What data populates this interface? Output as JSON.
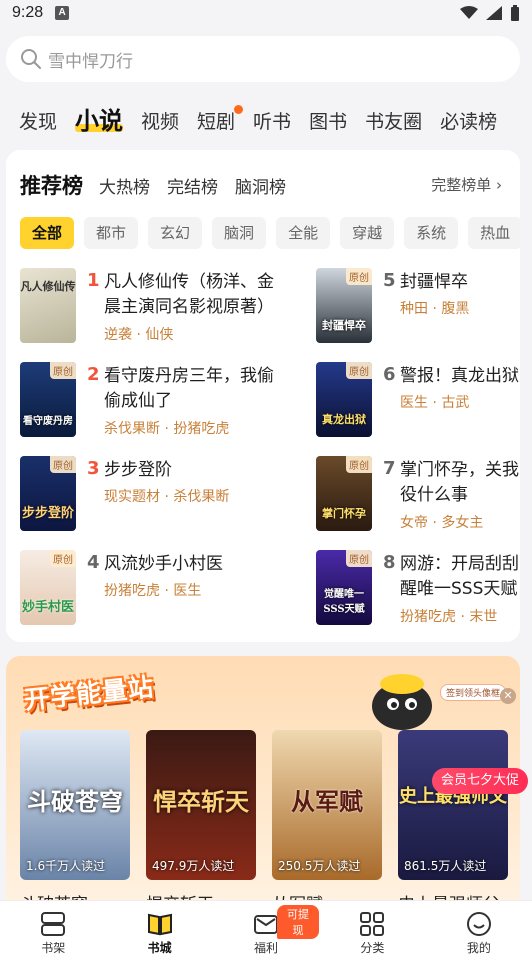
{
  "status": {
    "time": "9:28",
    "notify_letter": "A"
  },
  "search": {
    "placeholder": "雪中悍刀行"
  },
  "tabs": [
    {
      "label": "发现"
    },
    {
      "label": "小说"
    },
    {
      "label": "视频"
    },
    {
      "label": "短剧"
    },
    {
      "label": "听书"
    },
    {
      "label": "图书"
    },
    {
      "label": "书友圈"
    },
    {
      "label": "必读榜"
    }
  ],
  "rank": {
    "tabs": [
      "推荐榜",
      "大热榜",
      "完结榜",
      "脑洞榜"
    ],
    "all_label": "完整榜单 ›",
    "chips": [
      "全部",
      "都市",
      "玄幻",
      "脑洞",
      "全能",
      "穿越",
      "系统",
      "热血"
    ],
    "original_tag": "原创",
    "books": [
      {
        "rank": "1",
        "title": "凡人修仙传（杨洋、金晨主演同名影视原著）",
        "tags": "逆袭 · 仙侠",
        "cover_text": "凡人修仙传"
      },
      {
        "rank": "2",
        "title": "看守废丹房三年，我偷偷成仙了",
        "tags": "杀伐果断 · 扮猪吃虎",
        "cover_text": "看守废丹房"
      },
      {
        "rank": "3",
        "title": "步步登阶",
        "tags": "现实题材 · 杀伐果断",
        "cover_text": "步步登阶"
      },
      {
        "rank": "4",
        "title": "风流妙手小村医",
        "tags": "扮猪吃虎 · 医生",
        "cover_text": "妙手村医"
      },
      {
        "rank": "5",
        "title": "封疆悍卒",
        "tags": "种田 · 腹黑",
        "cover_text": "封疆悍卒"
      },
      {
        "rank": "6",
        "title": "警报！真龙出狱",
        "tags": "医生 · 古武",
        "cover_text": "真龙出狱"
      },
      {
        "rank": "7",
        "title": "掌门怀孕，关我役什么事",
        "tags": "女帝 · 多女主",
        "cover_text": "掌门怀孕"
      },
      {
        "rank": "8",
        "title": "网游：开局刮刮醒唯一SSS天赋",
        "tags": "扮猪吃虎 · 末世",
        "cover_text": "觉醒唯一SSS天赋"
      }
    ]
  },
  "promo": {
    "title": "开学能量站",
    "pill": "签到领头像框",
    "badge": "会员七夕大促",
    "books": [
      {
        "name": "斗破苍穹",
        "reads": "1.6千万人读过",
        "cover_text": "斗破苍穹"
      },
      {
        "name": "悍卒斩天",
        "reads": "497.9万人读过",
        "cover_text": "悍卒斩天"
      },
      {
        "name": "从军赋",
        "reads": "250.5万人读过",
        "cover_text": "从军赋"
      },
      {
        "name": "史上最强师父",
        "reads": "861.5万人读过",
        "cover_text": "史上最强师父"
      }
    ]
  },
  "nav": [
    {
      "label": "书架"
    },
    {
      "label": "书城"
    },
    {
      "label": "福利",
      "badge": "可提现"
    },
    {
      "label": "分类"
    },
    {
      "label": "我的"
    }
  ],
  "colors": {
    "accent": "#ffd22e",
    "rank_red": "#f2543a",
    "tag": "#c8813a"
  }
}
